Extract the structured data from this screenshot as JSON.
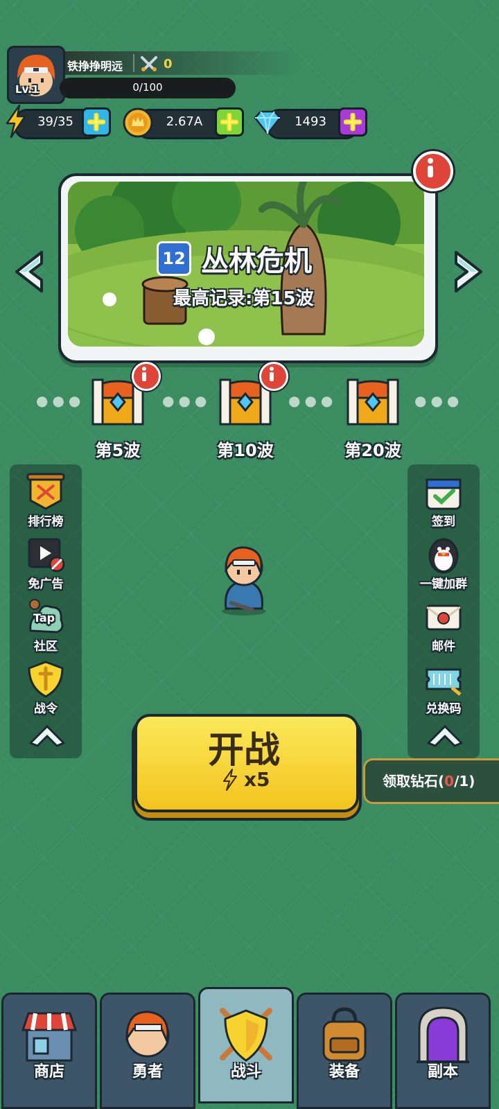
{
  "player": {
    "name": "铁挣挣明远",
    "level": "Lv.1",
    "power": "0",
    "exp": "0/100"
  },
  "resources": {
    "energy": "39/35",
    "gold": "2.67A",
    "diamonds": "1493"
  },
  "stage": {
    "number": "12",
    "title": "丛林危机",
    "record": "最高记录:第15波"
  },
  "chests": [
    {
      "label": "第5波",
      "has_alert": true
    },
    {
      "label": "第10波",
      "has_alert": true
    },
    {
      "label": "第20波",
      "has_alert": false
    }
  ],
  "left_menu": [
    {
      "label": "排行榜",
      "icon": "ranking-banner-icon"
    },
    {
      "label": "免广告",
      "icon": "no-ads-film-icon"
    },
    {
      "label": "社区",
      "icon": "taptap-community-icon",
      "badge": "Tap"
    },
    {
      "label": "战令",
      "icon": "battle-pass-shield-icon"
    }
  ],
  "right_menu": [
    {
      "label": "签到",
      "icon": "calendar-checkin-icon"
    },
    {
      "label": "一键加群",
      "icon": "qq-penguin-icon"
    },
    {
      "label": "邮件",
      "icon": "mail-envelope-icon"
    },
    {
      "label": "兑换码",
      "icon": "redeem-ticket-icon"
    }
  ],
  "fight": {
    "label": "开战",
    "cost": "x5"
  },
  "diamond_claim": {
    "prefix": "领取钻石(",
    "current": "0",
    "suffix": "/1)"
  },
  "nav": [
    {
      "label": "商店",
      "icon": "shop-icon"
    },
    {
      "label": "勇者",
      "icon": "hero-icon"
    },
    {
      "label": "战斗",
      "icon": "battle-shield-icon",
      "active": true
    },
    {
      "label": "装备",
      "icon": "backpack-icon"
    },
    {
      "label": "副本",
      "icon": "dungeon-gate-icon"
    }
  ],
  "colors": {
    "background": "#3b8c61",
    "fight_button": "#f6d32f",
    "alert_red": "#e0453a",
    "energy_plus": "#2fb5e6",
    "gold_plus": "#7ed53a",
    "diamond_plus": "#a83bd8"
  }
}
